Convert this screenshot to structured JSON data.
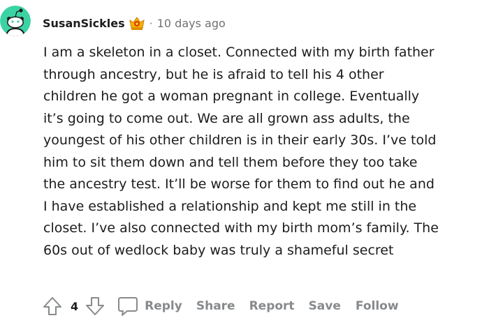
{
  "comment": {
    "username": "SusanSickles",
    "separator": "·",
    "timestamp": "10 days ago",
    "body_lines": [
      "I am a skeleton in a closet. Connected with my birth father",
      "through ancestry, but he is afraid to tell his 4 other",
      "children he got a woman pregnant in college. Eventually",
      "it’s going to come out. We are all grown ass adults, the",
      "youngest of his other children is in their early 30s. I’ve told",
      "him to sit them down and tell them before they too take",
      "the ancestry test. It’ll be worse for them to find out he and",
      "I have established a relationship and kept me still in the",
      "closet. I’ve also connected with my birth mom’s family. The",
      "60s out of wedlock baby was truly a shameful secret"
    ]
  },
  "actions": {
    "score": "4",
    "reply_label": "Reply",
    "share_label": "Share",
    "report_label": "Report",
    "save_label": "Save",
    "follow_label": "Follow"
  },
  "icons": {
    "avatar": "snoo-avatar-icon",
    "award": "award-badge-icon",
    "upvote": "upvote-arrow-icon",
    "downvote": "downvote-arrow-icon",
    "reply": "comment-bubble-icon"
  },
  "colors": {
    "avatar_bg": "#3bd3a4",
    "meta_gray": "#878a8c",
    "text": "#1c1c1c"
  }
}
